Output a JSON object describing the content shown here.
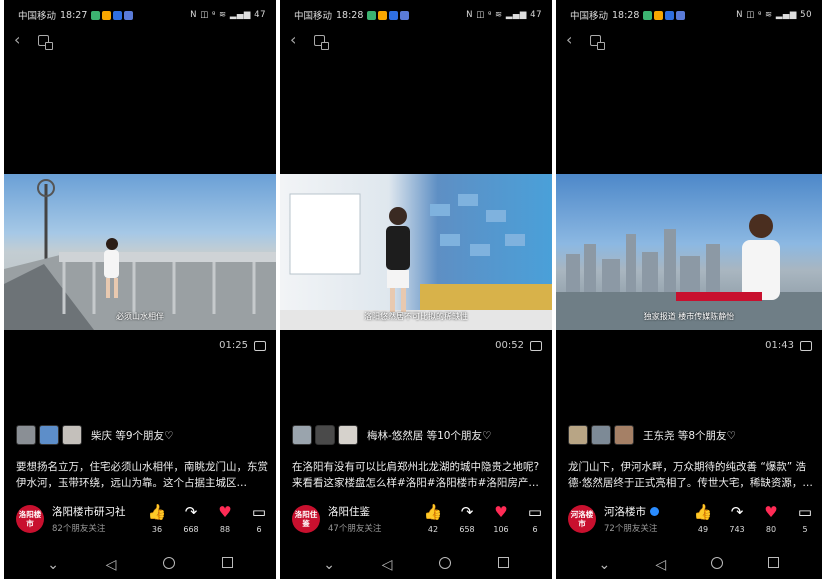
{
  "panels": [
    {
      "status": {
        "carrier": "中国移动",
        "time": "18:27",
        "right": "N ◫ ᵍ ≋ ▂▄▆ 47"
      },
      "video": {
        "subtitle": "必须山水相伴",
        "duration": "01:25"
      },
      "friends": {
        "text": "柴庆 等9个朋友♡"
      },
      "desc": "要想扬名立万，住宅必须山水相伴，南眺龙门山，东赏伊水河，玉带环绕，远山为靠。这个占据主城区…",
      "account": {
        "logo": "洛阳楼市",
        "name": "洛阳楼市研习社",
        "followers": "82个朋友关注"
      },
      "actions": {
        "like": "36",
        "share": "668",
        "fav": "88",
        "comment": "6"
      }
    },
    {
      "status": {
        "carrier": "中国移动",
        "time": "18:28",
        "right": "N ◫ ᵍ ≋ ▂▄▆ 47"
      },
      "video": {
        "subtitle": "洛阳悠然居不可比拟的稀缺性",
        "duration": "00:52"
      },
      "friends": {
        "text": "梅林-悠然居 等10个朋友♡"
      },
      "desc": "在洛阳有没有可以比肩郑州北龙湖的城中隐贵之地呢? 来看看这家楼盘怎么样#洛阳#洛阳楼市#洛阳房产…",
      "account": {
        "logo": "洛阳住鉴",
        "name": "洛阳住鉴",
        "followers": "47个朋友关注"
      },
      "actions": {
        "like": "42",
        "share": "658",
        "fav": "106",
        "comment": "6"
      }
    },
    {
      "status": {
        "carrier": "中国移动",
        "time": "18:28",
        "right": "N ◫ ᵍ ≋ ▂▄▆ 50"
      },
      "video": {
        "subtitle": "独家报道  楼市传媒陈静怡",
        "duration": "01:43"
      },
      "friends": {
        "text": "王东尧 等8个朋友♡"
      },
      "desc": "龙门山下，伊河水畔，万众期待的纯改善 “爆款” 浩德·悠然居终于正式亮相了。传世大宅，稀缺资源，…",
      "account": {
        "logo": "河洛楼市",
        "name": "河洛楼市",
        "followers": "72个朋友关注"
      },
      "actions": {
        "like": "49",
        "share": "743",
        "fav": "80",
        "comment": "5"
      }
    }
  ],
  "icons": {
    "back": "‹",
    "like": "👍",
    "share": "↷",
    "fav": "♥",
    "comment": "▭"
  },
  "colors": {
    "background": "#000000",
    "fav": "#ff2b55",
    "like": "#ff3040",
    "logo": "#c8102e"
  }
}
